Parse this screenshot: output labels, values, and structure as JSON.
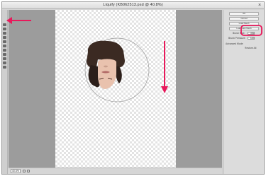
{
  "window": {
    "title": "Liquify (KB062513.psd @ 40.8%)",
    "close_glyph": "×"
  },
  "toolbox": {
    "tools": [
      {
        "name": "forward-warp-tool-icon"
      },
      {
        "name": "reconstruct-tool-icon"
      },
      {
        "name": "smooth-tool-icon"
      },
      {
        "name": "twirl-tool-icon"
      },
      {
        "name": "pucker-tool-icon"
      },
      {
        "name": "bloat-tool-icon"
      },
      {
        "name": "push-left-tool-icon"
      },
      {
        "name": "freeze-mask-tool-icon"
      },
      {
        "name": "thaw-mask-tool-icon"
      },
      {
        "name": "hand-tool-icon"
      },
      {
        "name": "zoom-tool-icon"
      }
    ]
  },
  "options_panel": {
    "ok_label": "OK",
    "cancel_label": "Cancel",
    "load_mesh_label": "Load Mesh",
    "load_last_mesh_label": "Load Last Mesh",
    "brush_size_label": "Brush Size:",
    "brush_size_value": "339",
    "brush_pressure_label": "Brush Pressure:",
    "brush_pressure_value": "100",
    "advanced_mode_label": "Advanced Mode",
    "restore_all_label": "Restore All"
  },
  "statusbar": {
    "zoom_value": "40.8%"
  },
  "colors": {
    "annotation": "#e8195b",
    "canvas_bg": "#9c9c9c",
    "checker": "#e3e3e3"
  }
}
